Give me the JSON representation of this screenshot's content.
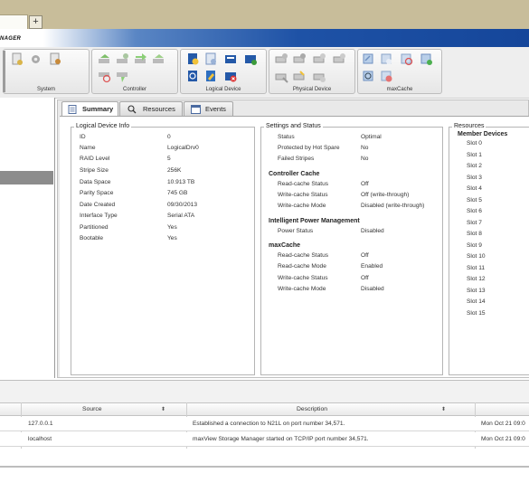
{
  "browser": {
    "new_tab_label": "+"
  },
  "brand": {
    "text": "NAGER"
  },
  "toolbar": {
    "groups": [
      {
        "label": "System"
      },
      {
        "label": "Controller"
      },
      {
        "label": "Logical Device"
      },
      {
        "label": "Physical Device"
      },
      {
        "label": "maxCache"
      }
    ]
  },
  "tabs": [
    {
      "label": "Summary"
    },
    {
      "label": "Resources"
    },
    {
      "label": "Events"
    }
  ],
  "logical_device_info": {
    "legend": "Logical Device Info",
    "fields": [
      {
        "label": "ID",
        "value": "0"
      },
      {
        "label": "Name",
        "value": "LogicalDrv0"
      },
      {
        "label": "RAID Level",
        "value": "5"
      },
      {
        "label": "Stripe Size",
        "value": "256K"
      },
      {
        "label": "Data Space",
        "value": "10.913 TB"
      },
      {
        "label": "Parity Space",
        "value": "745 GB"
      },
      {
        "label": "Date Created",
        "value": "09/30/2013"
      },
      {
        "label": "Interface Type",
        "value": "Serial ATA"
      },
      {
        "label": "Partitioned",
        "value": "Yes"
      },
      {
        "label": "Bootable",
        "value": "Yes"
      }
    ]
  },
  "settings_status": {
    "legend": "Settings and Status",
    "fields": [
      {
        "label": "Status",
        "value": "Optimal"
      },
      {
        "label": "Protected by Hot Spare",
        "value": "No"
      },
      {
        "label": "Failed Stripes",
        "value": "No"
      }
    ],
    "controller_cache": {
      "title": "Controller Cache",
      "fields": [
        {
          "label": "Read-cache Status",
          "value": "Off"
        },
        {
          "label": "Write-cache Status",
          "value": "Off (write-through)"
        },
        {
          "label": "Write-cache Mode",
          "value": "Disabled (write-through)"
        }
      ]
    },
    "power_mgmt": {
      "title": "Intelligent Power Management",
      "fields": [
        {
          "label": "Power Status",
          "value": "Disabled"
        }
      ]
    },
    "maxcache": {
      "title": "maxCache",
      "fields": [
        {
          "label": "Read-cache Status",
          "value": "Off"
        },
        {
          "label": "Read-cache Mode",
          "value": "Enabled"
        },
        {
          "label": "Write-cache Status",
          "value": "Off"
        },
        {
          "label": "Write-cache Mode",
          "value": "Disabled"
        }
      ]
    }
  },
  "resources": {
    "legend": "Resources",
    "member_title": "Member Devices",
    "slots": [
      "Slot 0",
      "Slot 1",
      "Slot 2",
      "Slot 3",
      "Slot 4",
      "Slot 5",
      "Slot 6",
      "Slot 7",
      "Slot 8",
      "Slot 9",
      "Slot 10",
      "Slot 11",
      "Slot 12",
      "Slot 13",
      "Slot 14",
      "Slot 15"
    ]
  },
  "events": {
    "columns": [
      {
        "label": "Source"
      },
      {
        "label": "Description"
      }
    ],
    "rows": [
      {
        "source": "127.0.0.1",
        "description": "Established a connection to N21L on port number 34,571.",
        "date": "Mon Oct 21 09:0"
      },
      {
        "source": "localhost",
        "description": "maxView Storage Manager started on TCP/IP port number 34,571.",
        "date": "Mon Oct 21 09:0"
      }
    ]
  }
}
